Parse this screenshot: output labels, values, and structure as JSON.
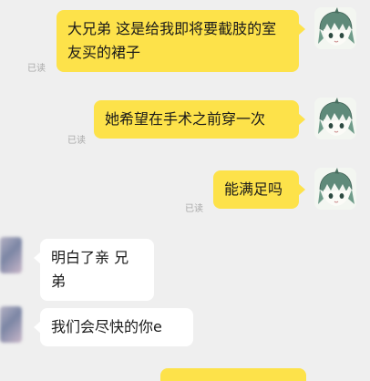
{
  "messages": [
    {
      "direction": "out",
      "text": "大兄弟 这是给我即将要截肢的室友买的裙子",
      "status": "已读"
    },
    {
      "direction": "out",
      "text": "她希望在手术之前穿一次",
      "status": "已读"
    },
    {
      "direction": "out",
      "text": "能满足吗",
      "status": "已读"
    },
    {
      "direction": "in",
      "text": "明白了亲 兄弟"
    },
    {
      "direction": "in",
      "text": "我们会尽快的你e"
    }
  ],
  "colors": {
    "outgoing_bubble": "#fde24a",
    "incoming_bubble": "#ffffff",
    "background": "#efefef",
    "read_receipt": "#a9a9a9"
  },
  "icons": {
    "self_avatar": "anime-character-avatar-icon",
    "contact_avatar": "blurred-avatar-icon"
  }
}
